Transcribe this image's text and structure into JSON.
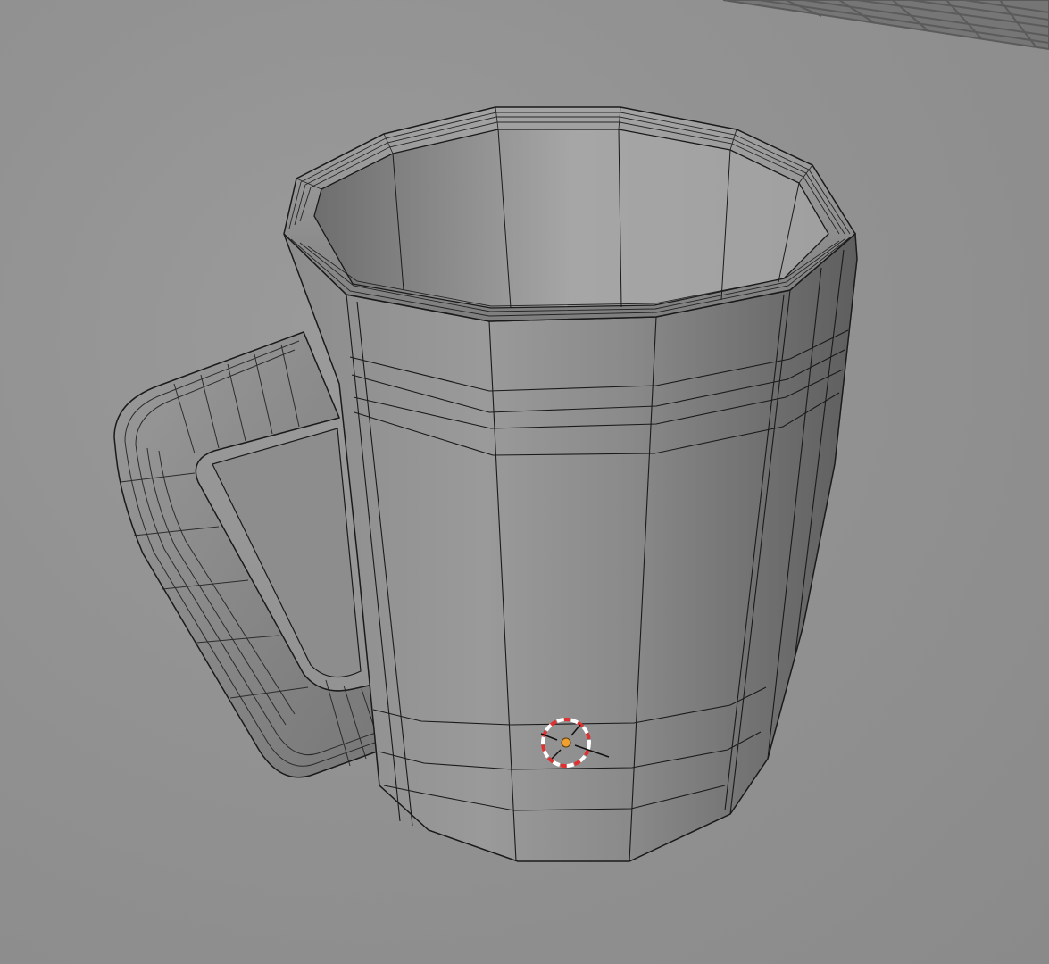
{
  "viewport": {
    "mode": "3d-viewport-edit-mode",
    "background": "#919191",
    "mesh_color": "#8a8a8a",
    "wire_color": "#1a1a1a",
    "cursor_colors": [
      "#ffffff",
      "#e03030"
    ],
    "origin_color": "#f0a030"
  },
  "scene": {
    "object": "mug-mesh",
    "icons": {
      "cursor": "3d-cursor-icon",
      "origin": "origin-point-icon"
    }
  }
}
